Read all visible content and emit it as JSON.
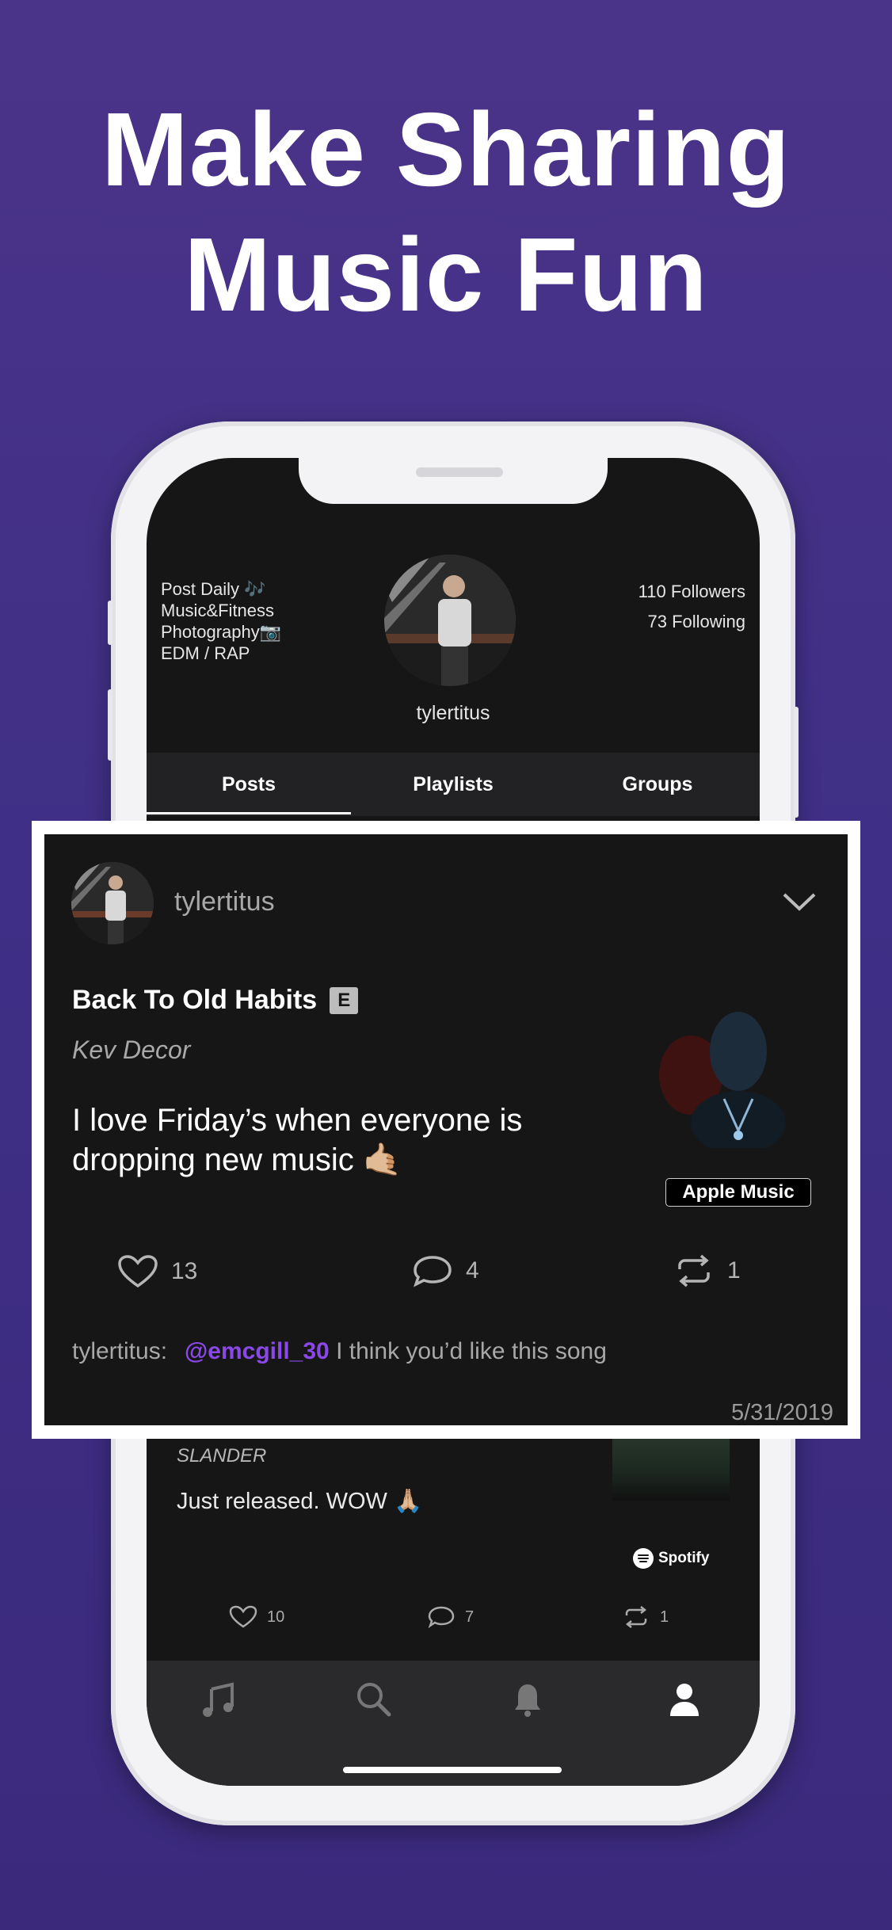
{
  "headline": {
    "line1": "Make Sharing",
    "line2": "Music Fun"
  },
  "profile": {
    "bio": [
      "Post Daily 🎶",
      "Music&Fitness",
      "Photography📷",
      "EDM / RAP"
    ],
    "followers": "110 Followers",
    "following": "73 Following",
    "username": "tylertitus"
  },
  "tabs": [
    {
      "label": "Posts",
      "active": true
    },
    {
      "label": "Playlists",
      "active": false
    },
    {
      "label": "Groups",
      "active": false
    }
  ],
  "featured_post": {
    "username": "tylertitus",
    "song_title": "Back To Old Habits",
    "explicit_label": "E",
    "artist": "Kev Decor",
    "caption": "I love Friday’s when everyone is dropping new music 🤙🏼",
    "service": "Apple Music",
    "likes": "13",
    "comments": "4",
    "reposts": "1",
    "comment": {
      "author": "tylertitus:",
      "mention": "@emcgill_30",
      "text": "I think you’d like this song"
    },
    "date": "5/31/2019"
  },
  "background_post": {
    "artist": "SLANDER",
    "caption": "Just released. WOW 🙏🏼",
    "service": "Spotify",
    "likes": "10",
    "comments": "7",
    "reposts": "1"
  },
  "bottom_nav": [
    "music-icon",
    "search-icon",
    "bell-icon",
    "profile-icon"
  ],
  "colors": {
    "background": "#45338a",
    "mention": "#8a48e8",
    "screen": "#161616"
  }
}
